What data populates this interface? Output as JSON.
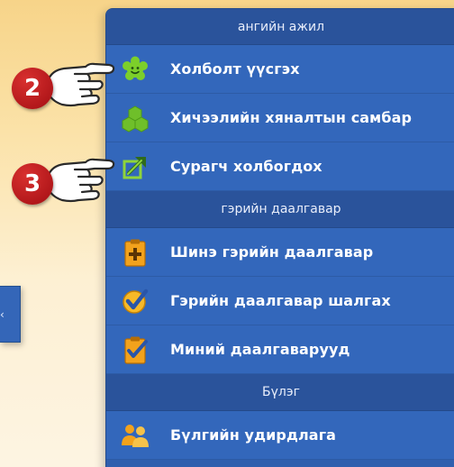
{
  "side_tab": {
    "glyph": "‹"
  },
  "sections": [
    {
      "header": "ангийн ажил",
      "items": [
        {
          "label": "Холболт үүсгэх",
          "icon": "smiley-flower-icon"
        },
        {
          "label": "Хичээлийн хяналтын самбар",
          "icon": "clover-icon"
        },
        {
          "label": "Сурагч холбогдох",
          "icon": "share-arrow-icon"
        }
      ]
    },
    {
      "header": "гэрийн даалгавар",
      "items": [
        {
          "label": "Шинэ гэрийн даалгавар",
          "icon": "add-clipboard-icon"
        },
        {
          "label": "Гэрийн даалгавар шалгах",
          "icon": "check-badge-icon"
        },
        {
          "label": "Миний даалгаварууд",
          "icon": "checked-clipboard-icon"
        }
      ]
    },
    {
      "header": "Бүлэг",
      "items": [
        {
          "label": "Бүлгийн удирдлага",
          "icon": "group-people-icon"
        }
      ]
    }
  ],
  "markers": [
    {
      "number": "2",
      "icon": "pointing-hand-icon"
    },
    {
      "number": "3",
      "icon": "pointing-hand-icon"
    }
  ],
  "colors": {
    "panel": "#3367bb",
    "header": "#2a539b",
    "badge": "#b3181b",
    "icon_green": "#7ccf2a",
    "icon_orange": "#f3a21c"
  }
}
